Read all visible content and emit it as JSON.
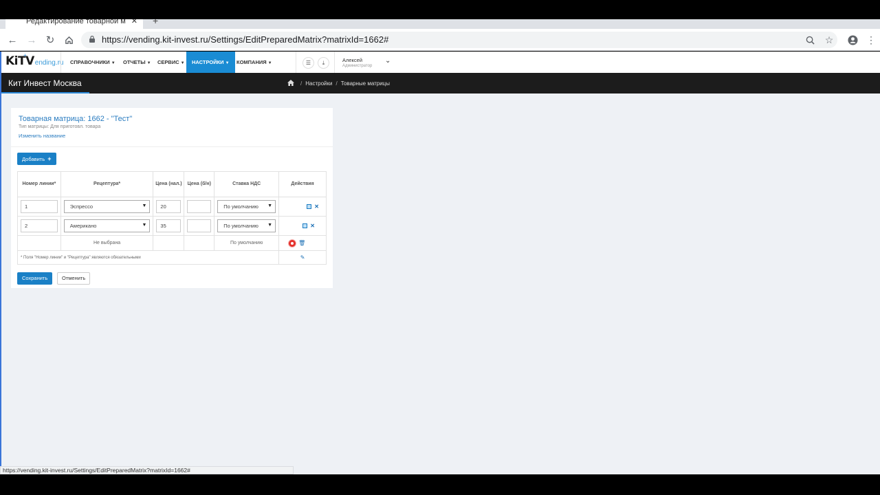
{
  "browser": {
    "tab_title": "Редактирование товарной м",
    "url": "https://vending.kit-invest.ru/Settings/EditPreparedMatrix?matrixId=1662#",
    "status_url": "https://vending.kit-invest.ru/Settings/EditPreparedMatrix?matrixId=1662#"
  },
  "logo": {
    "kit": "KiTV",
    "vending": "ending.ru"
  },
  "menu": [
    {
      "label": "СПРАВОЧНИКИ",
      "active": false
    },
    {
      "label": "ОТЧЕТЫ",
      "active": false
    },
    {
      "label": "СЕРВИС",
      "active": false
    },
    {
      "label": "НАСТРОЙКИ",
      "active": true
    },
    {
      "label": "КОМПАНИЯ",
      "active": false
    }
  ],
  "user": {
    "name": "Алексей",
    "role": "Администратор"
  },
  "header": {
    "company": "Кит Инвест Москва",
    "breadcrumb": [
      "Настройки",
      "Товарные матрицы"
    ]
  },
  "card": {
    "title": "Товарная матрица: 1662 - \"Тест\"",
    "type": "Тип матрицы: Для приготовл. товара",
    "rename_link": "Изменить название",
    "add_button": "Добавить"
  },
  "table": {
    "headers": [
      "Номер линии*",
      "Рецептура*",
      "Цена (нал.)",
      "Цена (б/н)",
      "Ставка НДС",
      "Действия"
    ],
    "rows": [
      {
        "line": "1",
        "recipe": "Эспрессо",
        "price_cash": "20",
        "price_cashless": "",
        "vat": "По умолчанию"
      },
      {
        "line": "2",
        "recipe": "Американо",
        "price_cash": "35",
        "price_cashless": "",
        "vat": "По умолчанию"
      }
    ],
    "empty_row": {
      "recipe": "Не выбрана",
      "vat": "По умолчанию"
    },
    "note": "* Поля \"Номер линии\" и \"Рецептура\" являются обязательными"
  },
  "buttons": {
    "save": "Сохранить",
    "cancel": "Отменить"
  },
  "colors": {
    "accent": "#1a80c6",
    "header_bg": "#1c1c1c",
    "page_bg": "#eef1f5"
  }
}
